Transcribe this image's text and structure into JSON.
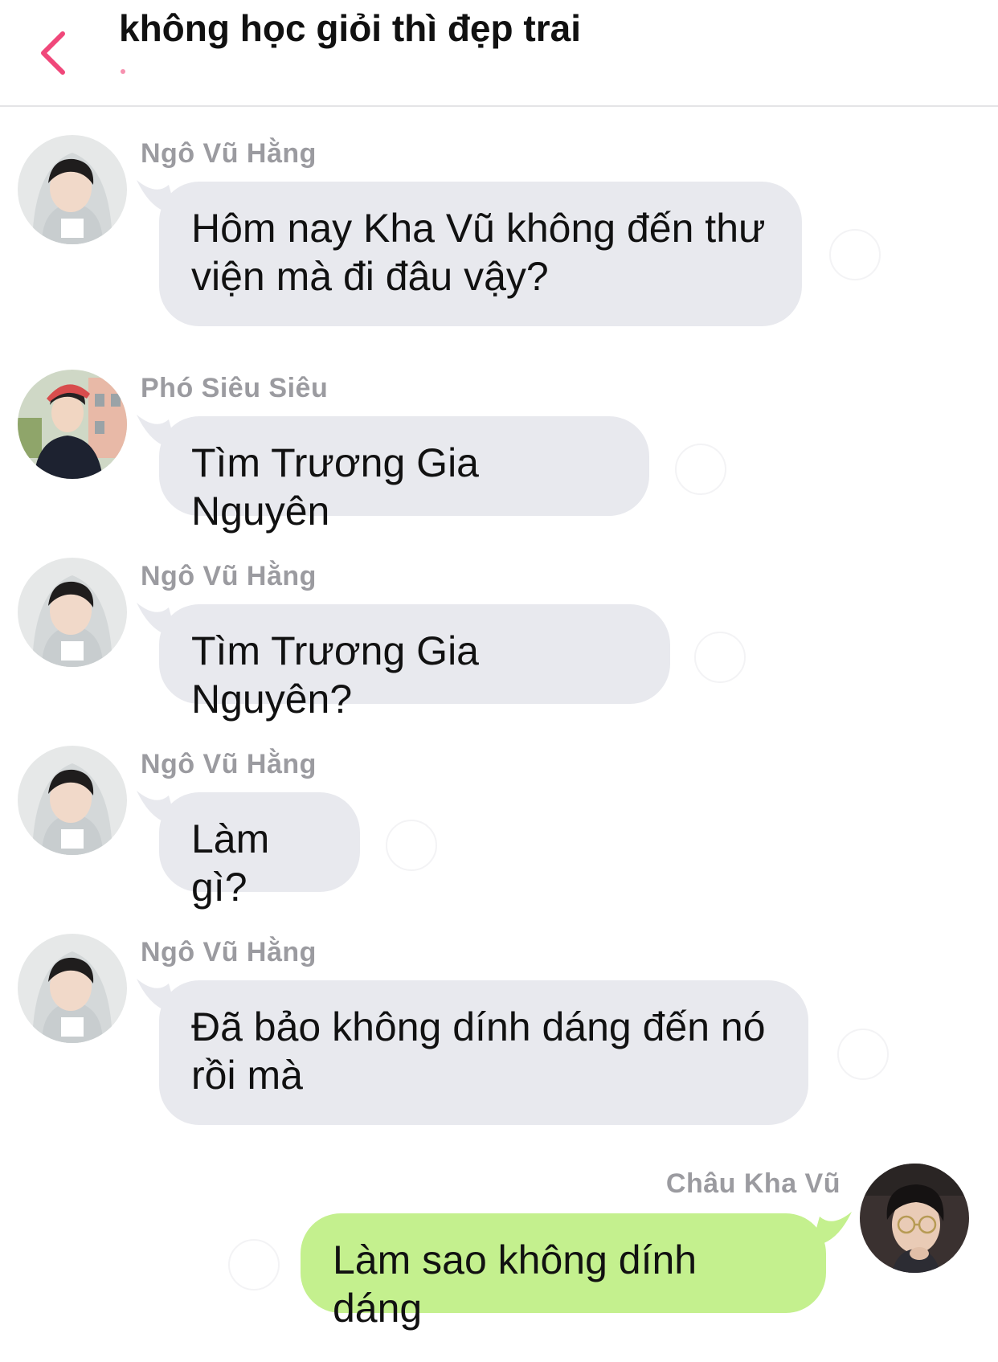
{
  "header": {
    "back_icon": "chevron-left-icon",
    "title": "không học giỏi thì đẹp trai",
    "accent": "#f0477a"
  },
  "messages": [
    {
      "sender": "Ngô Vũ Hằng",
      "text": "Hôm nay Kha Vũ không đến thư viện mà đi đâu vậy?",
      "side": "left"
    },
    {
      "sender": "Phó Siêu Siêu",
      "text": "Tìm Trương Gia Nguyên",
      "side": "left"
    },
    {
      "sender": "Ngô Vũ Hằng",
      "text": "Tìm Trương Gia Nguyên?",
      "side": "left"
    },
    {
      "sender": "Ngô Vũ Hằng",
      "text": "Làm gì?",
      "side": "left"
    },
    {
      "sender": "Ngô Vũ Hằng",
      "text": "Đã bảo không dính dáng đến nó rồi mà",
      "side": "left"
    },
    {
      "sender": "Châu Kha Vũ",
      "text": "Làm sao không dính dáng",
      "side": "right"
    }
  ],
  "colors": {
    "bubble_other": "#e8e9ee",
    "bubble_mine": "#c4f08e",
    "sender_name": "#9b9ba0"
  }
}
